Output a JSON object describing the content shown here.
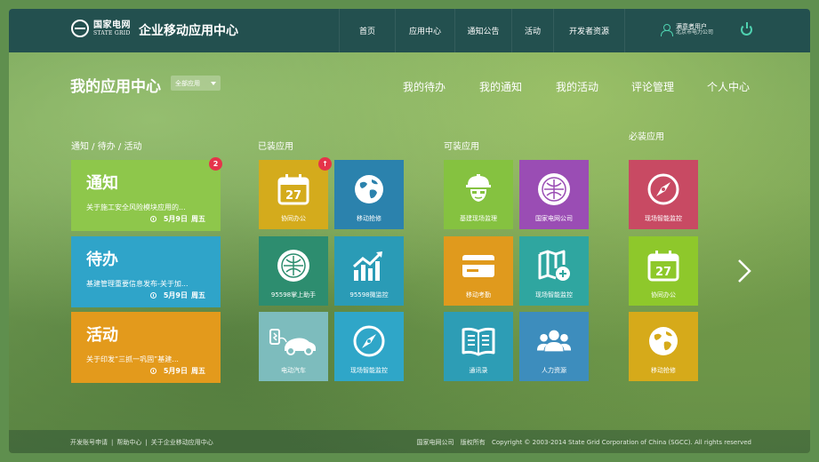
{
  "header": {
    "logo_cn": "国家电网",
    "logo_en": "STATE GRID",
    "site_title": "企业移动应用中心",
    "nav": [
      "首页",
      "应用中心",
      "通知公告",
      "活动",
      "开发者资源"
    ],
    "user_name": "满意者用户",
    "user_org": "北京市电力公司"
  },
  "page": {
    "title": "我的应用中心",
    "filter": "全部应用",
    "subnav": [
      "我的待办",
      "我的通知",
      "我的活动",
      "评论管理",
      "个人中心"
    ]
  },
  "sections": {
    "col1": "通知 / 待办 / 活动",
    "col2": "已装应用",
    "col3": "可装应用",
    "col4": "必装应用"
  },
  "cards": [
    {
      "title": "通知",
      "desc": "关于施工安全风险模块应用的...",
      "date": "5月9日",
      "weekday": "周五",
      "badge": "2",
      "color": "#8ec74b"
    },
    {
      "title": "待办",
      "desc": "基建管理重要信息发布-关于加...",
      "date": "5月9日",
      "weekday": "周五",
      "color": "#2fa4c9"
    },
    {
      "title": "活动",
      "desc": "关于印发“三抓一巩固”基建...",
      "date": "5月9日",
      "weekday": "周五",
      "color": "#e39a1c"
    }
  ],
  "installed": [
    {
      "label": "协同办公",
      "icon": "calendar-icon",
      "color": "#d4ab1c",
      "badge": "↑"
    },
    {
      "label": "移动抢修",
      "icon": "globe-icon",
      "color": "#2b82ad"
    },
    {
      "label": "95598掌上助手",
      "icon": "state-grid-logo-icon",
      "color": "#2d8d6f"
    },
    {
      "label": "95598微监控",
      "icon": "chart-icon",
      "color": "#2a9bb6"
    },
    {
      "label": "电动汽车",
      "icon": "electric-car-icon",
      "color": "#7dbcbd"
    },
    {
      "label": "现场智能监控",
      "icon": "compass-icon",
      "color": "#2fa6c8"
    }
  ],
  "installable": [
    {
      "label": "基建现场监理",
      "icon": "worker-icon",
      "color": "#85c240"
    },
    {
      "label": "国家电网公司",
      "icon": "state-grid-logo-icon",
      "color": "#9a4db4"
    },
    {
      "label": "移动考勤",
      "icon": "card-icon",
      "color": "#e09a1d"
    },
    {
      "label": "现场智能监控",
      "icon": "map-add-icon",
      "color": "#2fa6a0"
    },
    {
      "label": "通讯录",
      "icon": "book-icon",
      "color": "#2d9db5"
    },
    {
      "label": "人力资源",
      "icon": "people-icon",
      "color": "#3d8dbd"
    }
  ],
  "required": [
    {
      "label": "现场智能监控",
      "icon": "compass-icon",
      "color": "#c84a63"
    },
    {
      "label": "协同办公",
      "icon": "calendar-icon",
      "color": "#8ec82b"
    },
    {
      "label": "移动抢修",
      "icon": "globe-icon",
      "color": "#d6aa1a"
    }
  ],
  "calendar_day": "27",
  "footer": {
    "left": [
      "开发账号申请",
      "帮助中心",
      "关于企业移动应用中心"
    ],
    "company": "国家电网公司",
    "rights": "版权所有",
    "copyright": "Copyright © 2003-2014 State Grid Corporation of China (SGCC). All rights reserved"
  }
}
